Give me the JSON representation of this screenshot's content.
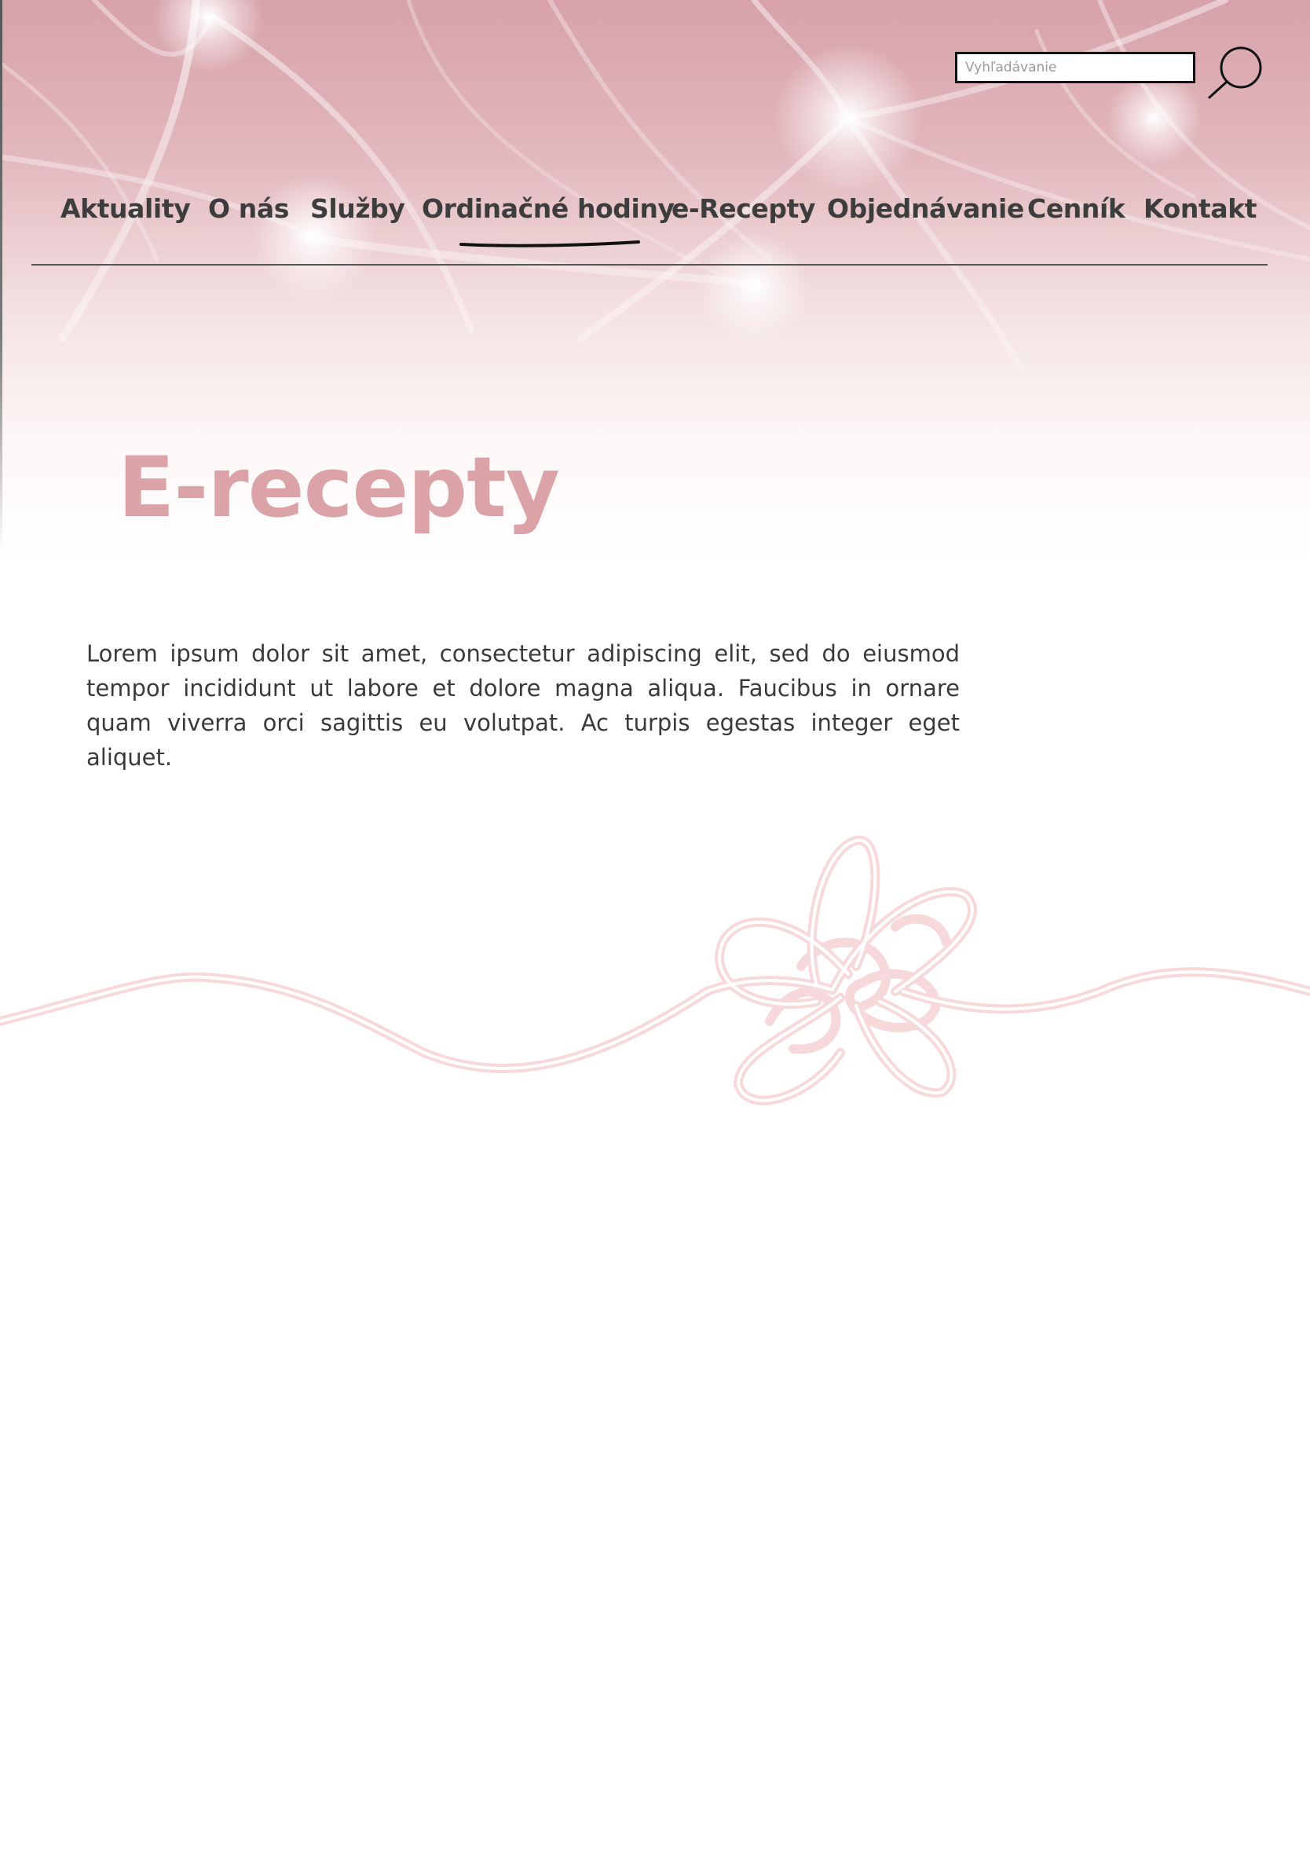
{
  "search": {
    "placeholder": "Vyhľadávanie",
    "value": ""
  },
  "nav": {
    "items": [
      {
        "label": "Aktuality"
      },
      {
        "label": "O nás"
      },
      {
        "label": "Služby"
      },
      {
        "label": "Ordinačné hodiny",
        "active": true
      },
      {
        "label": "e-Recepty"
      },
      {
        "label": "Objednávanie"
      },
      {
        "label": "Cenník"
      },
      {
        "label": "Kontakt"
      }
    ]
  },
  "page": {
    "title": "E-recepty",
    "intro": "Lorem ipsum dolor sit amet, consectetur adipiscing elit, sed do eiusmod tempor incididunt ut labore et dolore magna aliqua. Faucibus in ornare quam viverra orci sagittis eu volutpat. Ac turpis egestas integer eget aliquet."
  },
  "colors": {
    "accent": "#dba2a8",
    "hero_tint": "#d9a6ad",
    "text": "#3d3d3d",
    "decor": "#f7d9db"
  },
  "icons": {
    "search": "search-icon",
    "decor": "ribbon-knot-ornament"
  }
}
